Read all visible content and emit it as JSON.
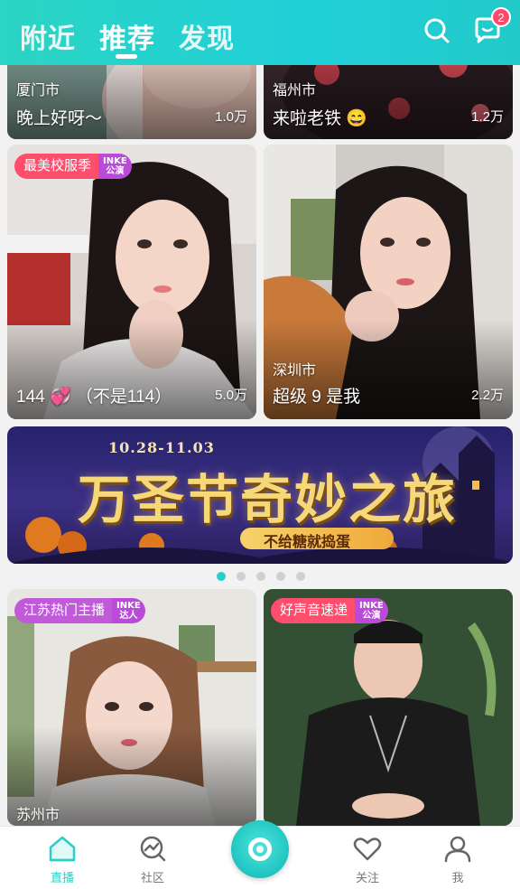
{
  "header": {
    "tabs": [
      {
        "label": "附近",
        "active": false
      },
      {
        "label": "推荐",
        "active": true
      },
      {
        "label": "发现",
        "active": false
      }
    ],
    "icons": {
      "search": "search-icon",
      "messages": "chat-bubble-icon"
    },
    "message_badge": "2"
  },
  "cards": [
    {
      "city": "厦门市",
      "title": "晚上好呀～",
      "viewers": "1.0万",
      "tag": null
    },
    {
      "city": "福州市",
      "title": "来啦老铁 😄",
      "viewers": "1.2万",
      "tag": null
    },
    {
      "city": "",
      "title": "144 💞 （不是114）",
      "viewers": "5.0万",
      "tag": {
        "text": "最美校服季",
        "badge_top": "INKE",
        "badge_bottom": "公演",
        "color": "#ff4d6d"
      }
    },
    {
      "city": "深圳市",
      "title": "超级 9 是我",
      "viewers": "2.2万",
      "tag": null
    },
    {
      "city": "苏州市",
      "title": "",
      "viewers": "",
      "tag": {
        "text": "江苏热门主播",
        "badge_top": "INKE",
        "badge_bottom": "达人",
        "color": "#c05ad8"
      }
    },
    {
      "city": "",
      "title": "",
      "viewers": "",
      "tag": {
        "text": "好声音速递",
        "badge_top": "INKE",
        "badge_bottom": "公演",
        "color": "#ff4d6d"
      }
    }
  ],
  "banner": {
    "date": "10.28-11.03",
    "title": "万圣节奇妙之旅",
    "subtitle": "不给糖就捣蛋"
  },
  "carousel": {
    "count": 5,
    "active_index": 0
  },
  "bottom_nav": [
    {
      "label": "直播",
      "icon": "home-icon",
      "active": true
    },
    {
      "label": "社区",
      "icon": "community-icon",
      "active": false
    },
    {
      "label": "",
      "icon": "live-record-icon",
      "active": false
    },
    {
      "label": "关注",
      "icon": "heart-icon",
      "active": false
    },
    {
      "label": "我",
      "icon": "profile-icon",
      "active": false
    }
  ],
  "colors": {
    "accent": "#2bcfc7",
    "header": "#20d0d8",
    "badge": "#ff4b6b"
  }
}
